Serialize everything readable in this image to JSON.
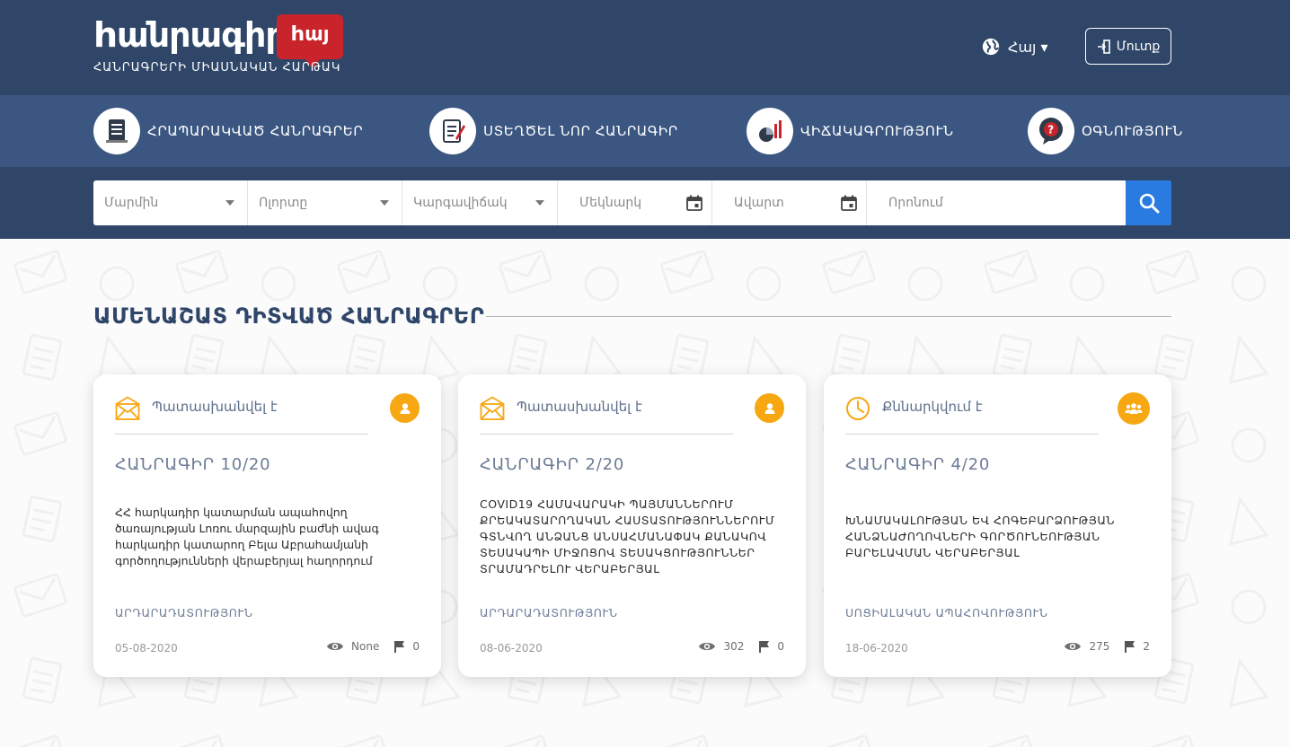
{
  "header": {
    "logo_word": "hանրագիր!",
    "logo_badge": "hայ",
    "tagline": "ՀԱՆՐԱԳՐԵՐԻ ՄԻԱՍՆԱԿԱՆ ՀԱՐԹԱԿ",
    "language": "Հայ ▾",
    "login": "Մուտք"
  },
  "nav": [
    {
      "label": "ՀՐԱՊԱՐԱԿՎԱԾ ՀԱՆՐԱԳՐԵՐ",
      "icon": "published-petitions-icon"
    },
    {
      "label": "ՍՏԵՂԾԵԼ ՆՈՐ ՀԱՆՐԱԳԻՐ",
      "icon": "create-petition-icon"
    },
    {
      "label": "ՎԻՃԱԿԱԳՐՈՒԹՅՈՒՆ",
      "icon": "statistics-icon"
    },
    {
      "label": "ՕԳՆՈՒԹՅՈՒՆ",
      "icon": "help-icon"
    }
  ],
  "filters": {
    "body": "Մարմին",
    "field": "Ոլորտը",
    "status": "Կարգավիճակ",
    "start": "Մեկնարկ",
    "end": "Ավարտ",
    "search": "Որոնում"
  },
  "section_title": "ԱՄԵՆԱՇԱՏ ԴԻՏՎԱԾ ՀԱՆՐԱԳՐԵՐ",
  "cards": [
    {
      "status": "Պատասխանվել է",
      "status_icon": "envelope-icon",
      "badge_icon": "single-user-icon",
      "title": "ՀԱՆՐԱԳԻՐ 10/20",
      "description": "ՀՀ հարկադիր կատարման ապահովող ծառայության Լոռու մարզային բաժնի ավագ հարկադիր կատարող Բելա Աբրահամյանի գործողությունների վերաբերյալ հաղորդում",
      "category": "ԱՐԴԱՐԱԴԱՏՈՒԹՅՈՒՆ",
      "date": "05-08-2020",
      "views": "None",
      "flags": "0"
    },
    {
      "status": "Պատասխանվել է",
      "status_icon": "envelope-icon",
      "badge_icon": "single-user-icon",
      "title": "ՀԱՆՐԱԳԻՐ 2/20",
      "description": "COVID19 ՀԱՄԱՎԱՐԱԿԻ ՊԱՅՄԱՆՆԵՐՈՒՄ ՔՐԵԱԿԱՏԱՐՈՂԱԿԱՆ ՀԱՍՏԱՏՈՒԹՅՈՒՆՆԵՐՈՒՄ ԳՏՆՎՈՂ ԱՆՁԱՆՑ ԱՆՍԱՀՄԱՆԱՓԱԿ ՔԱՆԱԿՈՎ ՏԵՍԱԿԱՊԻ ՄԻՋՈՑՈՎ ՏԵՍԱԿՑՈՒԹՅՈՒՆՆԵՐ ՏՐԱՄԱԴՐԵԼՈՒ ՎԵՐԱԲԵՐՅԱԼ",
      "category": "ԱՐԴԱՐԱԴԱՏՈՒԹՅՈՒՆ",
      "date": "08-06-2020",
      "views": "302",
      "flags": "0"
    },
    {
      "status": "Քննարկվում է",
      "status_icon": "clock-icon",
      "badge_icon": "group-users-icon",
      "title": "ՀԱՆՐԱԳԻՐ 4/20",
      "description": "ԽՆԱՄԱԿԱԼՈՒԹՅԱՆ ԵՎ ՀՈԳԵԲԱՐՁՈՒԹՅԱՆ ՀԱՆՁՆԱԺՈՂՈՎՆԵՐԻ ԳՈՐԾՈՒՆԵՈՒԹՅԱՆ ԲԱՐԵԼԱՎՄԱՆ ՎԵՐԱԲԵՐՅԱԼ",
      "category": "ՍՈՑԻԱԼԱԿԱՆ ԱՊԱՀՈՎՈՒԹՅՈՒՆ",
      "date": "18-06-2020",
      "views": "275",
      "flags": "2"
    }
  ],
  "colors": {
    "header": "#2f4669",
    "nav": "#3a5681",
    "accent": "#f7a712",
    "search_button": "#2a7be0",
    "logo_red": "#c9242b"
  }
}
